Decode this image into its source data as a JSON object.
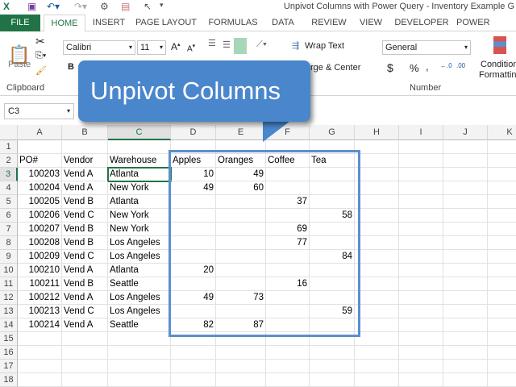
{
  "title": "Unpivot Columns with Power Query - Inventory Example G",
  "tabs": [
    "FILE",
    "HOME",
    "INSERT",
    "PAGE LAYOUT",
    "FORMULAS",
    "DATA",
    "REVIEW",
    "VIEW",
    "DEVELOPER",
    "POWER QUERY"
  ],
  "ribbon": {
    "paste": "Paste",
    "clipboard": "Clipboard",
    "font": "Calibri",
    "size": "11",
    "bold": "B",
    "wrap": "Wrap Text",
    "merge": "rge & Center",
    "numfmt": "General",
    "number": "Number",
    "currency": "$",
    "percent": "%",
    "comma": ",",
    "cond1": "Condition",
    "cond2": "Formatting"
  },
  "name_box": "C3",
  "callout": "Unpivot Columns",
  "columns": [
    "A",
    "B",
    "C",
    "D",
    "E",
    "F",
    "G",
    "H",
    "I",
    "J",
    "K"
  ],
  "rows": [
    "1",
    "2",
    "3",
    "4",
    "5",
    "6",
    "7",
    "8",
    "9",
    "10",
    "11",
    "12",
    "13",
    "14",
    "15",
    "16",
    "17",
    "18"
  ],
  "headers": [
    "PO#",
    "Vendor",
    "Warehouse",
    "Apples",
    "Oranges",
    "Coffee",
    "Tea"
  ],
  "data": [
    [
      "100203",
      "Vend A",
      "Atlanta",
      "10",
      "49",
      "",
      ""
    ],
    [
      "100204",
      "Vend A",
      "New York",
      "49",
      "60",
      "",
      ""
    ],
    [
      "100205",
      "Vend B",
      "Atlanta",
      "",
      "",
      "37",
      ""
    ],
    [
      "100206",
      "Vend C",
      "New York",
      "",
      "",
      "",
      "58"
    ],
    [
      "100207",
      "Vend B",
      "New York",
      "",
      "",
      "69",
      ""
    ],
    [
      "100208",
      "Vend B",
      "Los Angeles",
      "",
      "",
      "77",
      ""
    ],
    [
      "100209",
      "Vend C",
      "Los Angeles",
      "",
      "",
      "",
      "84"
    ],
    [
      "100210",
      "Vend A",
      "Atlanta",
      "20",
      "",
      "",
      ""
    ],
    [
      "100211",
      "Vend B",
      "Seattle",
      "",
      "",
      "16",
      ""
    ],
    [
      "100212",
      "Vend A",
      "Los Angeles",
      "49",
      "73",
      "",
      ""
    ],
    [
      "100213",
      "Vend C",
      "Los Angeles",
      "",
      "",
      "",
      "59"
    ],
    [
      "100214",
      "Vend A",
      "Seattle",
      "82",
      "87",
      "",
      ""
    ]
  ],
  "accent": "#217346"
}
